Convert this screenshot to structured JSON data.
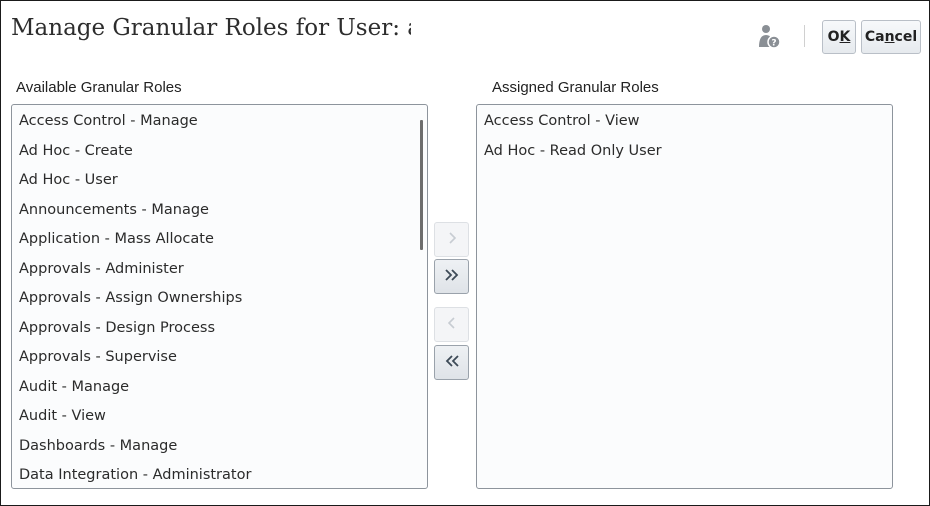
{
  "dialog": {
    "title": "Manage Granular Roles for User: ak",
    "ok_label_prefix": "O",
    "ok_label_underline": "K",
    "cancel_label_prefix": "Ca",
    "cancel_label_underline": "n",
    "cancel_label_suffix": "cel"
  },
  "available": {
    "label": "Available Granular Roles",
    "items": [
      "Access Control - Manage",
      "Ad Hoc - Create",
      "Ad Hoc - User",
      "Announcements - Manage",
      "Application - Mass Allocate",
      "Approvals - Administer",
      "Approvals - Assign Ownerships",
      "Approvals - Design Process",
      "Approvals - Supervise",
      "Audit - Manage",
      "Audit - View",
      "Dashboards - Manage",
      "Data Integration - Administrator"
    ]
  },
  "assigned": {
    "label": "Assigned Granular Roles",
    "items": [
      "Access Control - View",
      "Ad Hoc - Read Only User"
    ]
  },
  "colors": {
    "enabled_arrow": "#3d4a57",
    "disabled_arrow": "#c7ccd2"
  }
}
